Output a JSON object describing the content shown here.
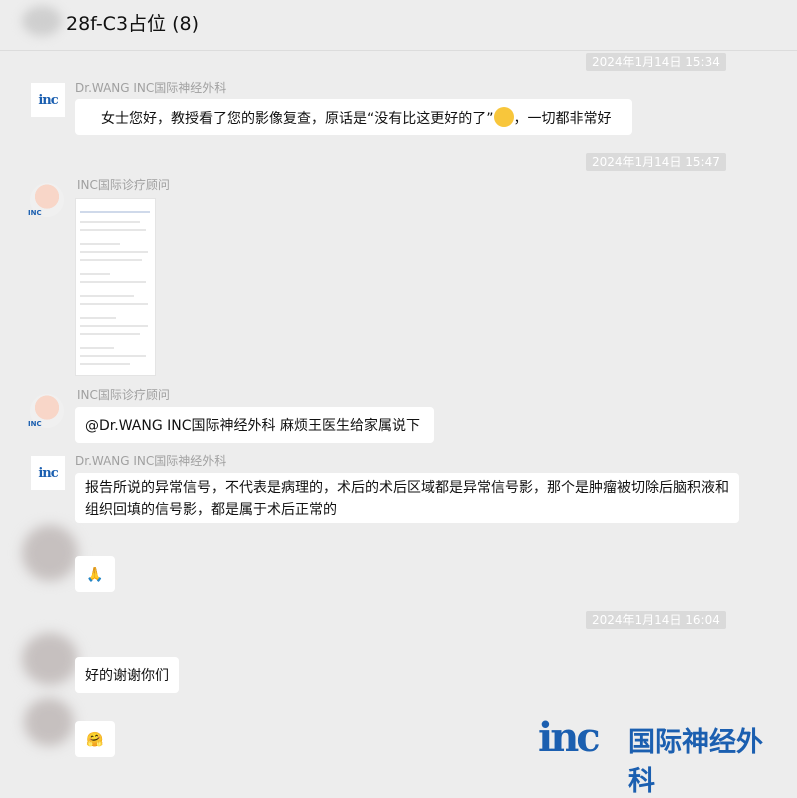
{
  "header": {
    "title": "28f-C3占位 (8)"
  },
  "timestamps": [
    "2024年1月14日 15:34",
    "2024年1月14日 15:47",
    "2024年1月14日 16:04"
  ],
  "messages": [
    {
      "sender": "Dr.WANG  INC国际神经外科",
      "text": "女士您好，教授看了您的影像复查，原话是“没有比这更好的了”",
      "text_suffix": "，一切都非常好"
    },
    {
      "sender": "INC国际诊疗顾问"
    },
    {
      "sender": "INC国际诊疗顾问",
      "text": "@Dr.WANG  INC国际神经外科 麻烦王医生给家属说下"
    },
    {
      "sender": "Dr.WANG  INC国际神经外科",
      "text": "报告所说的异常信号，不代表是病理的，术后的术后区域都是异常信号影，那个是肿瘤被切除后脑积液和组织回填的信号影，都是属于术后正常的"
    },
    {
      "emoji": "🙏"
    },
    {
      "text": "好的谢谢你们"
    },
    {
      "emoji": "🤗"
    }
  ],
  "avatars": {
    "inc_logo_text": "inc",
    "nurse_badge": "INC"
  },
  "watermark": {
    "mark": "inc",
    "text": "国际神经外科"
  },
  "colors": {
    "brand_blue": "#1b5fb0",
    "background": "#ededed",
    "bubble": "#ffffff"
  }
}
